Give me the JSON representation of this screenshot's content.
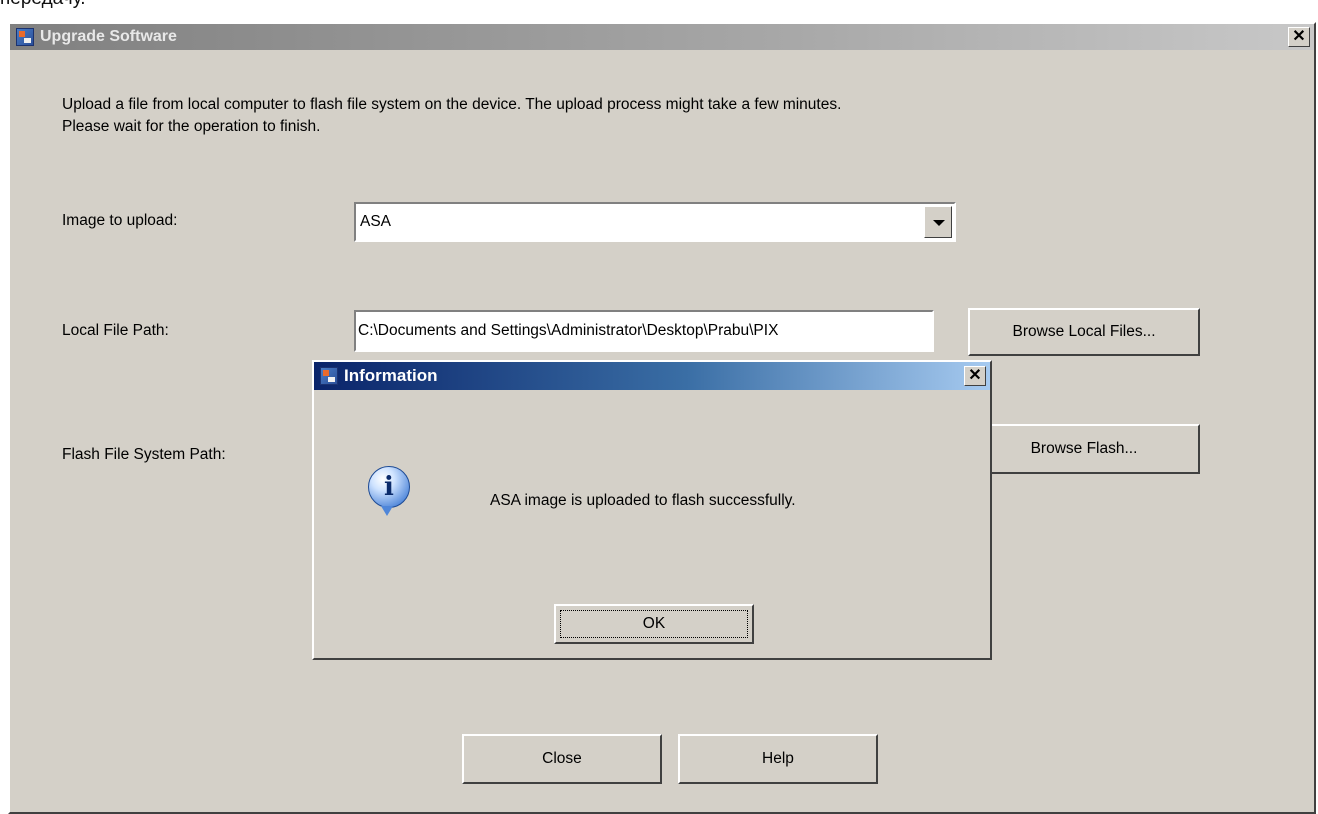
{
  "page": {
    "top_caption": "передачу."
  },
  "window": {
    "title": "Upgrade Software",
    "intro_line1": "Upload a file from local computer to flash file system on the device. The upload process might take a few minutes.",
    "intro_line2": "Please wait for the operation to finish.",
    "image_label": "Image to upload:",
    "image_value": "ASA",
    "local_path_label": "Local File Path:",
    "local_path_value": "C:\\Documents and Settings\\Administrator\\Desktop\\Prabu\\PIX",
    "browse_local_label": "Browse Local Files...",
    "flash_path_label": "Flash File System Path:",
    "browse_flash_label": "Browse Flash...",
    "close_label": "Close",
    "help_label": "Help"
  },
  "dialog": {
    "title": "Information",
    "message": "ASA image is uploaded to flash successfully.",
    "ok_label": "OK"
  },
  "icons": [
    "app-icon",
    "close-icon",
    "chevron-down-icon",
    "info-icon"
  ]
}
